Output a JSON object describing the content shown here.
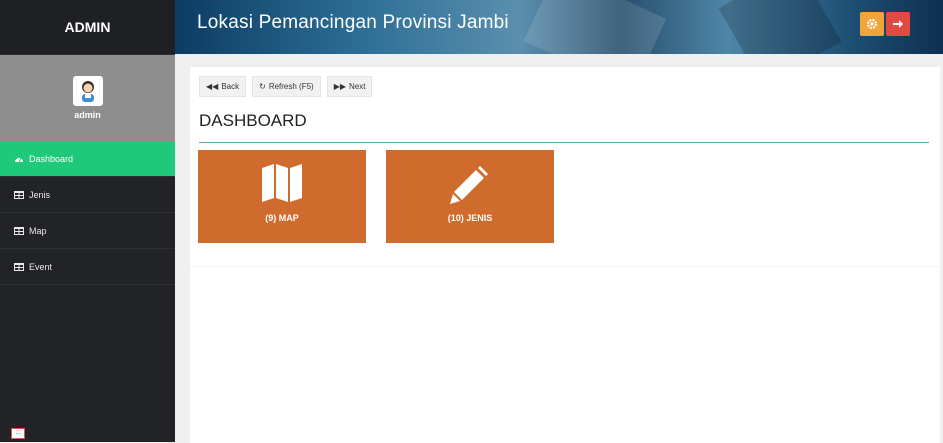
{
  "app": {
    "brand": "ADMIN",
    "title": "Lokasi Pemancingan Provinsi Jambi"
  },
  "profile": {
    "name": "admin"
  },
  "sidebar": {
    "items": [
      {
        "label": "Dashboard",
        "icon": "dashboard-icon",
        "active": true
      },
      {
        "label": "Jenis",
        "icon": "table-icon"
      },
      {
        "label": "Map",
        "icon": "table-icon"
      },
      {
        "label": "Event",
        "icon": "table-icon"
      }
    ]
  },
  "header": {
    "settings_icon": "gear-icon",
    "logout_icon": "arrow-right-icon",
    "settings_color": "#f0a43a",
    "logout_color": "#e14b44"
  },
  "toolbar": {
    "back_label": "Back",
    "refresh_label": "Refresh (F5)",
    "next_label": "Next"
  },
  "main": {
    "title": "DASHBOARD",
    "cards": [
      {
        "label": "(9) MAP",
        "icon": "map-icon"
      },
      {
        "label": "(10) JENIS",
        "icon": "pencil-icon"
      }
    ]
  },
  "colors": {
    "accent_active": "#1ec97a",
    "card": "#cf6c2d",
    "sidebar": "#222326"
  }
}
